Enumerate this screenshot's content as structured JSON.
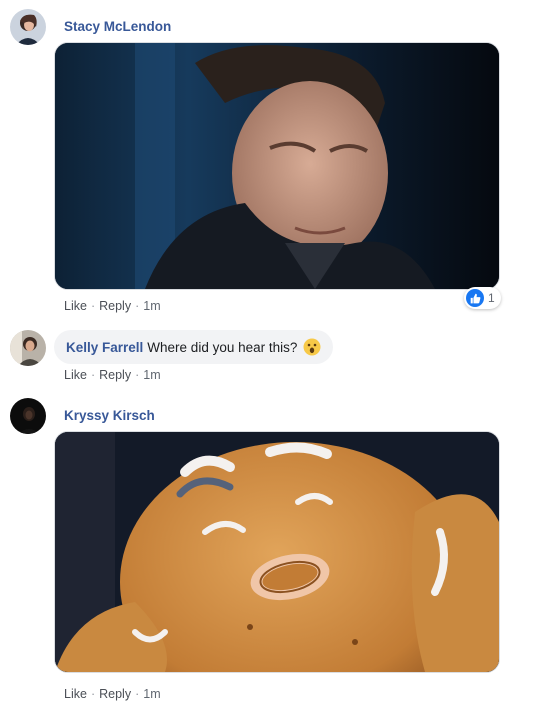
{
  "comments": [
    {
      "author": "Stacy McLendon",
      "media_icon": "gif-man-blinking",
      "actions": {
        "like": "Like",
        "reply": "Reply",
        "time": "1m"
      },
      "reactions": {
        "icon": "like-icon",
        "count": "1",
        "color": "#1877f2"
      }
    },
    {
      "author": "Kelly Farrell",
      "text": "Where did you hear this?",
      "emoji": "astonished-face-icon",
      "actions": {
        "like": "Like",
        "reply": "Reply",
        "time": "1m"
      }
    },
    {
      "author": "Kryssy Kirsch",
      "media_icon": "gif-gingerbread-man",
      "actions": {
        "like": "Like",
        "reply": "Reply",
        "time": "1m"
      }
    }
  ],
  "separator": "·",
  "colors": {
    "author_link": "#385898",
    "action_text": "#606770",
    "bubble_bg": "#f2f3f5"
  }
}
